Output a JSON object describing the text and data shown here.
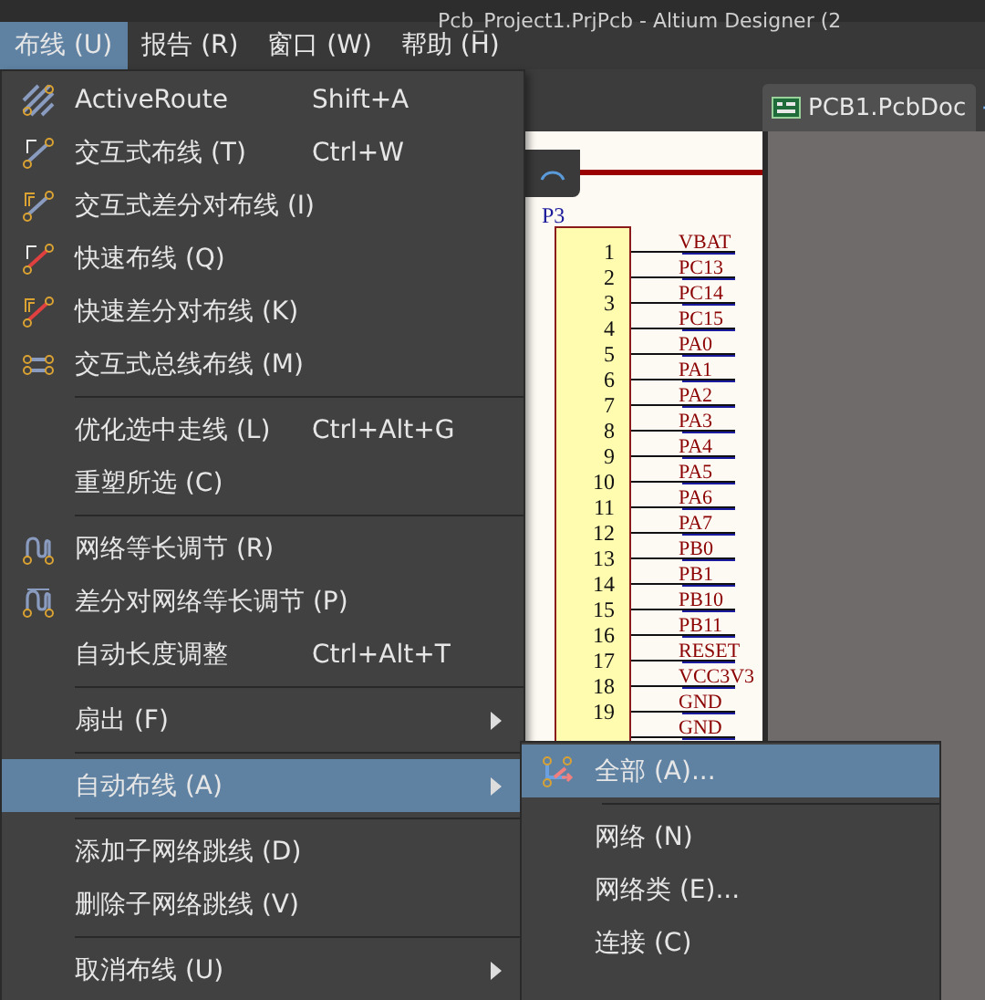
{
  "window": {
    "title": "Pcb_Project1.PrjPcb - Altium Designer (2"
  },
  "menu_bar": [
    {
      "label": "布线 (U)",
      "selected": true
    },
    {
      "label": "报告 (R)",
      "selected": false
    },
    {
      "label": "窗口 (W)",
      "selected": false
    },
    {
      "label": "帮助 (H)",
      "selected": false
    }
  ],
  "menu": [
    {
      "kind": "item",
      "label": "ActiveRoute",
      "shortcut": "Shift+A",
      "selected": false,
      "submenu": false
    },
    {
      "kind": "item",
      "label": "交互式布线 (T)",
      "shortcut": "Ctrl+W",
      "selected": false,
      "submenu": false
    },
    {
      "kind": "item",
      "label": "交互式差分对布线 (I)",
      "selected": false,
      "submenu": false
    },
    {
      "kind": "item",
      "label": "快速布线 (Q)",
      "selected": false,
      "submenu": false
    },
    {
      "kind": "item",
      "label": "快速差分对布线 (K)",
      "selected": false,
      "submenu": false
    },
    {
      "kind": "item",
      "label": "交互式总线布线 (M)",
      "selected": false,
      "submenu": false
    },
    {
      "kind": "separator"
    },
    {
      "kind": "item",
      "label": "优化选中走线 (L)",
      "shortcut": "Ctrl+Alt+G",
      "selected": false,
      "submenu": false
    },
    {
      "kind": "item",
      "label": "重塑所选 (C)",
      "selected": false,
      "submenu": false
    },
    {
      "kind": "separator"
    },
    {
      "kind": "item",
      "label": "网络等长调节 (R)",
      "selected": false,
      "submenu": false
    },
    {
      "kind": "item",
      "label": "差分对网络等长调节 (P)",
      "selected": false,
      "submenu": false
    },
    {
      "kind": "item",
      "label": "自动长度调整",
      "shortcut": "Ctrl+Alt+T",
      "selected": false,
      "submenu": false
    },
    {
      "kind": "separator"
    },
    {
      "kind": "item",
      "label": "扇出 (F)",
      "selected": false,
      "submenu": true
    },
    {
      "kind": "separator"
    },
    {
      "kind": "item",
      "label": "自动布线 (A)",
      "selected": true,
      "submenu": true
    },
    {
      "kind": "separator"
    },
    {
      "kind": "item",
      "label": "添加子网络跳线 (D)",
      "selected": false,
      "submenu": false
    },
    {
      "kind": "item",
      "label": "删除子网络跳线 (V)",
      "selected": false,
      "submenu": false
    },
    {
      "kind": "separator"
    },
    {
      "kind": "item",
      "label": "取消布线 (U)",
      "selected": false,
      "submenu": true
    }
  ],
  "submenu": [
    {
      "kind": "item",
      "label": "全部 (A)...",
      "selected": true
    },
    {
      "kind": "separator"
    },
    {
      "kind": "item",
      "label": "网络 (N)",
      "selected": false
    },
    {
      "kind": "item",
      "label": "网络类 (E)...",
      "selected": false
    },
    {
      "kind": "item",
      "label": "连接 (C)",
      "selected": false
    }
  ],
  "document_tab": {
    "label": "PCB1.PcbDoc"
  },
  "schematic": {
    "designator": "P3",
    "pins": [
      {
        "number": "1",
        "net": "VBAT"
      },
      {
        "number": "2",
        "net": "PC13"
      },
      {
        "number": "3",
        "net": "PC14"
      },
      {
        "number": "4",
        "net": "PC15"
      },
      {
        "number": "5",
        "net": "PA0"
      },
      {
        "number": "6",
        "net": "PA1"
      },
      {
        "number": "7",
        "net": "PA2"
      },
      {
        "number": "8",
        "net": "PA3"
      },
      {
        "number": "9",
        "net": "PA4"
      },
      {
        "number": "10",
        "net": "PA5"
      },
      {
        "number": "11",
        "net": "PA6"
      },
      {
        "number": "12",
        "net": "PA7"
      },
      {
        "number": "13",
        "net": "PB0"
      },
      {
        "number": "14",
        "net": "PB1"
      },
      {
        "number": "15",
        "net": "PB10"
      },
      {
        "number": "16",
        "net": "PB11"
      },
      {
        "number": "17",
        "net": "RESET"
      },
      {
        "number": "18",
        "net": "VCC3V3"
      },
      {
        "number": "19",
        "net": "GND"
      },
      {
        "net": "GND"
      }
    ]
  }
}
